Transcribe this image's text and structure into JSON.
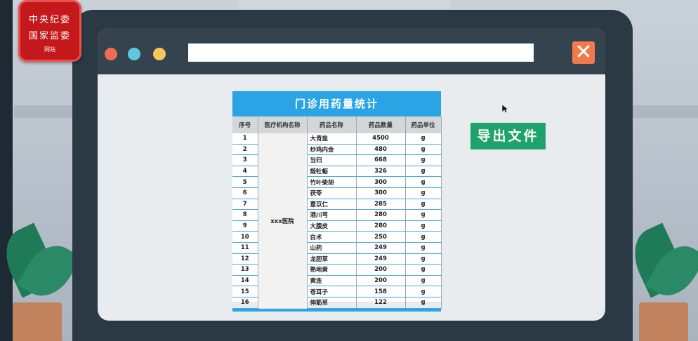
{
  "logo": {
    "line1": "中央纪委",
    "line2": "国家监委",
    "line3": "网站"
  },
  "browser": {
    "url": "",
    "dots": [
      {
        "name": "red",
        "color": "#ef6d55"
      },
      {
        "name": "blue",
        "color": "#5fc8e0"
      },
      {
        "name": "yellow",
        "color": "#f6c75a"
      }
    ],
    "close_icon": "close-icon"
  },
  "report": {
    "title": "门诊用药量统计",
    "headers": [
      "序号",
      "医疗机构名称",
      "药品名称",
      "药品数量",
      "药品单位"
    ],
    "hospital": "xxx医院",
    "rows": [
      {
        "no": "1",
        "name": "大青盐",
        "qty": "4500",
        "unit": "g"
      },
      {
        "no": "2",
        "name": "炒鸡内金",
        "qty": "480",
        "unit": "g"
      },
      {
        "no": "3",
        "name": "当归",
        "qty": "668",
        "unit": "g"
      },
      {
        "no": "4",
        "name": "煅牡蛎",
        "qty": "326",
        "unit": "g"
      },
      {
        "no": "5",
        "name": "竹叶柴胡",
        "qty": "300",
        "unit": "g"
      },
      {
        "no": "6",
        "name": "茯苓",
        "qty": "300",
        "unit": "g"
      },
      {
        "no": "7",
        "name": "薏苡仁",
        "qty": "285",
        "unit": "g"
      },
      {
        "no": "8",
        "name": "酒川芎",
        "qty": "280",
        "unit": "g"
      },
      {
        "no": "9",
        "name": "大腹皮",
        "qty": "280",
        "unit": "g"
      },
      {
        "no": "10",
        "name": "白术",
        "qty": "250",
        "unit": "g"
      },
      {
        "no": "11",
        "name": "山药",
        "qty": "249",
        "unit": "g"
      },
      {
        "no": "12",
        "name": "龙胆草",
        "qty": "249",
        "unit": "g"
      },
      {
        "no": "13",
        "name": "熟地黄",
        "qty": "200",
        "unit": "g"
      },
      {
        "no": "14",
        "name": "黄连",
        "qty": "200",
        "unit": "g"
      },
      {
        "no": "15",
        "name": "苍耳子",
        "qty": "158",
        "unit": "g"
      },
      {
        "no": "16",
        "name": "伸筋草",
        "qty": "122",
        "unit": "g"
      }
    ]
  },
  "export_button": {
    "label": "导出文件",
    "color": "#1fa36c"
  },
  "colors": {
    "accent": "#2aa4e4",
    "laptop": "#2b3944",
    "toolbar": "#34434e"
  }
}
